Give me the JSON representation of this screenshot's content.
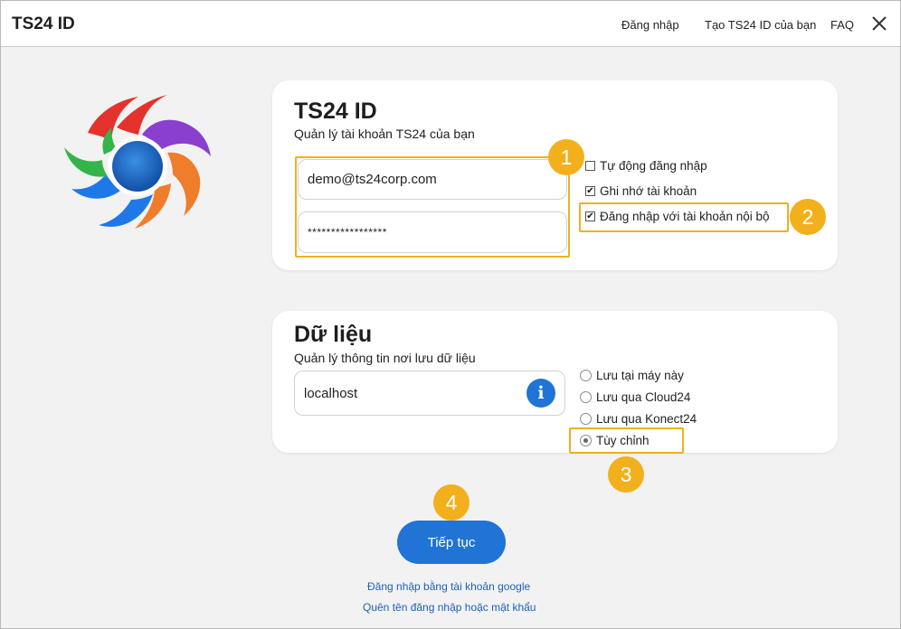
{
  "header": {
    "app_title": "TS24 ID",
    "nav": [
      "Đăng nhập",
      "Tạo TS24 ID của bạn",
      "FAQ"
    ],
    "close_icon": "close-icon"
  },
  "account_card": {
    "title": "TS24 ID",
    "subtitle": "Quản lý tài khoản TS24 của bạn",
    "email_value": "demo@ts24corp.com",
    "password_value": "*****************",
    "options": [
      {
        "label": "Tự động đăng nhập",
        "checked": false
      },
      {
        "label": "Ghi nhớ tài khoản",
        "checked": true
      },
      {
        "label": "Đăng nhập với tài khoản nội bộ",
        "checked": true
      }
    ]
  },
  "data_card": {
    "title": "Dữ liệu",
    "subtitle": "Quản lý thông tin nơi lưu dữ liệu",
    "server_value": "localhost",
    "info_icon_glyph": "i",
    "storage_options": [
      {
        "label": "Lưu tại máy này",
        "selected": false
      },
      {
        "label": "Lưu qua Cloud24",
        "selected": false
      },
      {
        "label": "Lưu qua Konect24",
        "selected": false
      },
      {
        "label": "Tùy chỉnh",
        "selected": true
      }
    ]
  },
  "callouts": [
    "1",
    "2",
    "3",
    "4"
  ],
  "actions": {
    "continue_label": "Tiếp tục",
    "google_login": "Đăng nhập bằng tài khoản google",
    "forgot": "Quên tên đăng nhập hoặc mật khẩu"
  },
  "colors": {
    "accent_blue": "#1f74d6",
    "highlight": "#f0b020",
    "badge": "#f3b01d"
  }
}
